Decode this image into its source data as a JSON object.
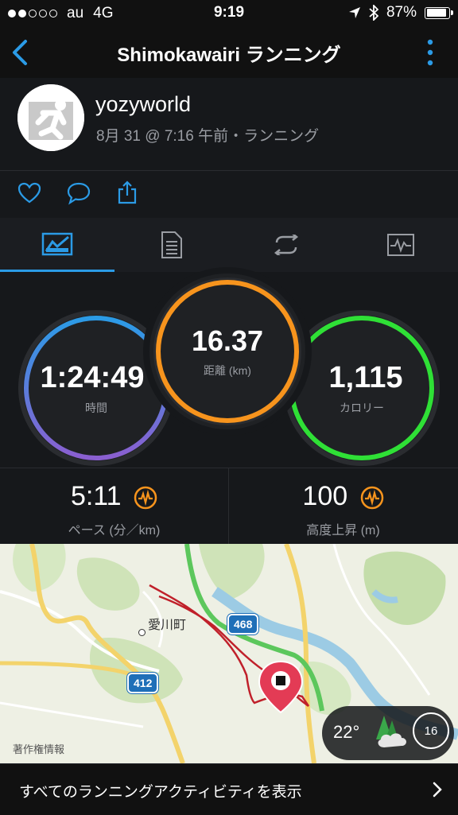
{
  "status_bar": {
    "carrier": "au",
    "network": "4G",
    "time": "9:19",
    "battery": "87%"
  },
  "nav": {
    "title": "Shimokawairi ランニング",
    "back_icon": "chevron-left",
    "more_icon": "vertical-ellipsis"
  },
  "activity": {
    "user": "yozyworld",
    "subtitle": "8月 31 @ 7:16 午前・ランニング"
  },
  "actions": [
    "heart-icon",
    "comment-icon",
    "share-icon"
  ],
  "tabs": [
    "summary-icon",
    "details-icon",
    "laps-icon",
    "chart-icon"
  ],
  "stats": {
    "time": {
      "value": "1:24:49",
      "label": "時間"
    },
    "distance": {
      "value": "16.37",
      "label": "距離 (km)"
    },
    "calories": {
      "value": "1,115",
      "label": "カロリー"
    }
  },
  "metrics": {
    "pace": {
      "value": "5:11",
      "label": "ペース (分／km)"
    },
    "elevation": {
      "value": "100",
      "label": "高度上昇 (m)"
    }
  },
  "map": {
    "town": "愛川町",
    "route_468": "468",
    "route_412": "412",
    "attribution": "著作権情報",
    "temperature": "22°",
    "wind": "16"
  },
  "footer": {
    "label": "すべてのランニングアクティビティを表示"
  },
  "colors": {
    "accent": "#2b9be6",
    "time_ring": "#5a7fd8",
    "distance_ring": "#f7941d",
    "calories_ring": "#2fe036",
    "route": "#c0202a"
  }
}
